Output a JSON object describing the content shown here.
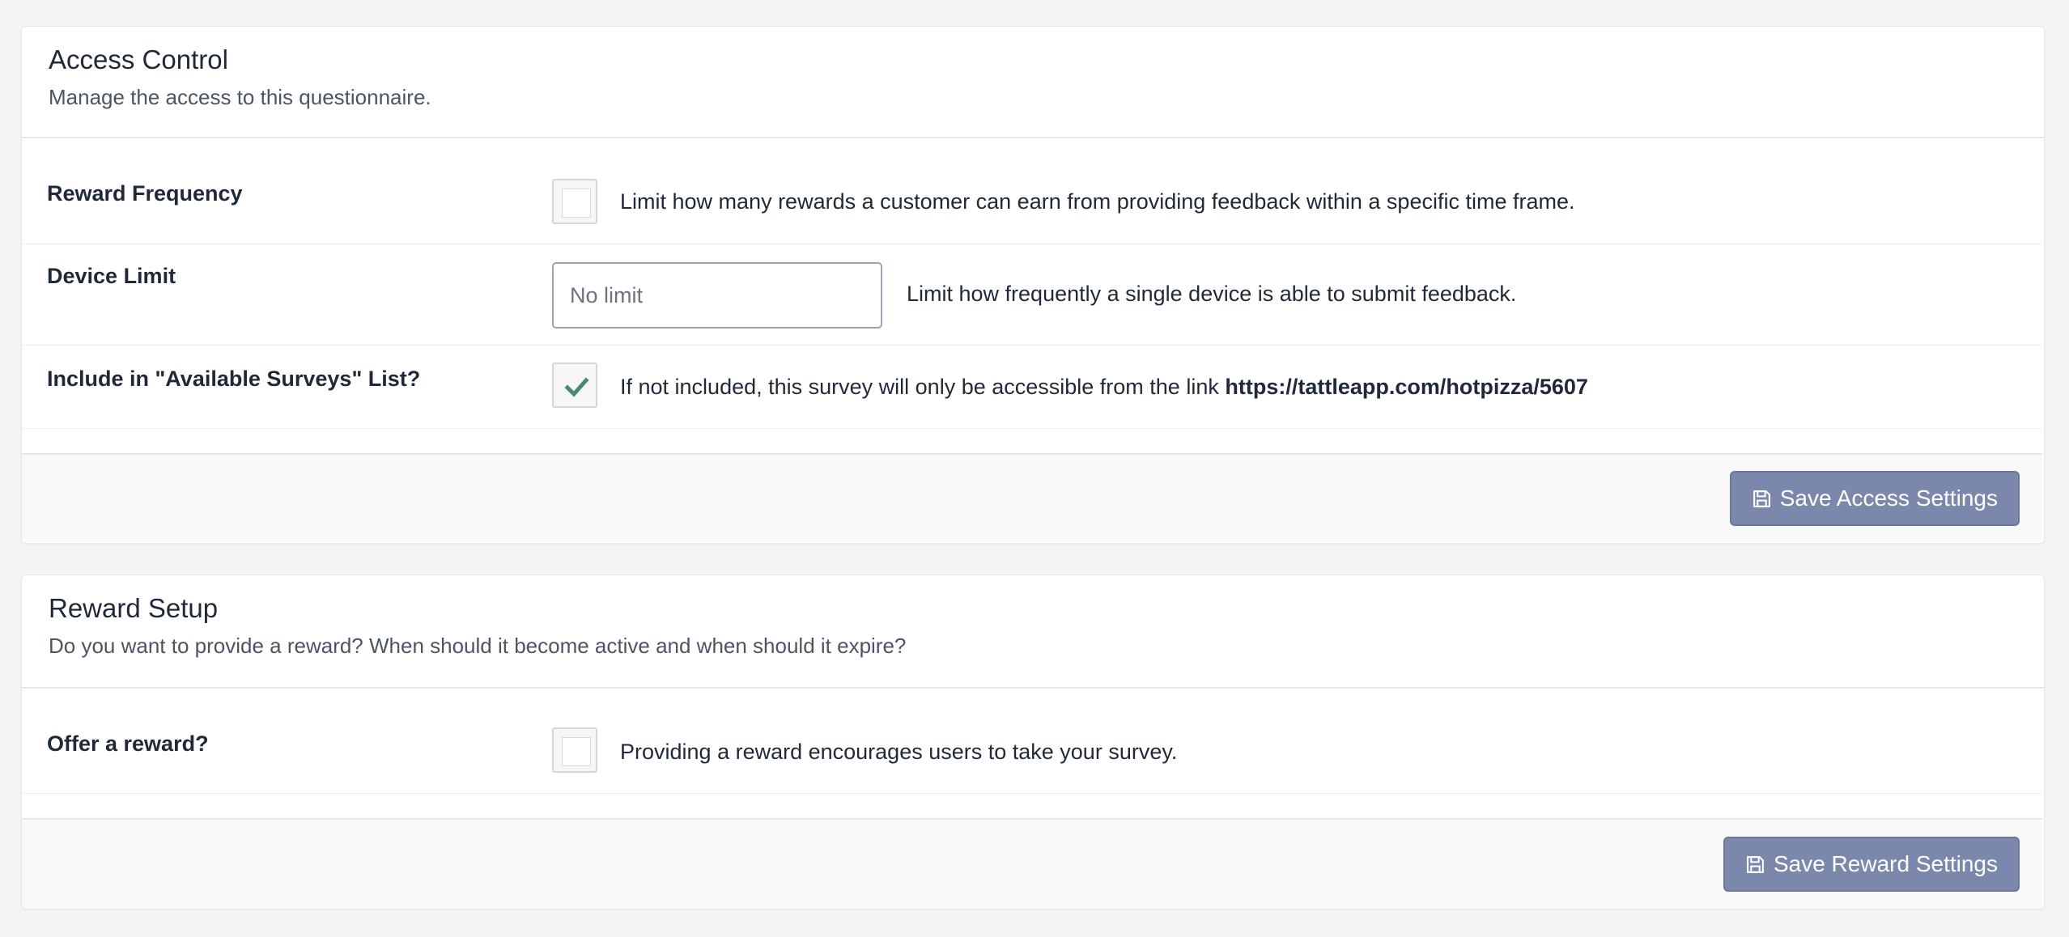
{
  "access_control": {
    "title": "Access Control",
    "subtitle": "Manage the access to this questionnaire.",
    "reward_frequency": {
      "label": "Reward Frequency",
      "checked": false,
      "help": "Limit how many rewards a customer can earn from providing feedback within a specific time frame."
    },
    "device_limit": {
      "label": "Device Limit",
      "value": "",
      "placeholder": "No limit",
      "help": "Limit how frequently a single device is able to submit feedback."
    },
    "available_surveys": {
      "label": "Include in \"Available Surveys\" List?",
      "checked": true,
      "help": "If not included, this survey will only be accessible from the link",
      "link": "https://tattleapp.com/hotpizza/5607"
    },
    "save_label": "Save Access Settings"
  },
  "reward_setup": {
    "title": "Reward Setup",
    "subtitle": "Do you want to provide a reward? When should it become active and when should it expire?",
    "offer_reward": {
      "label": "Offer a reward?",
      "checked": false,
      "help": "Providing a reward encourages users to take your survey."
    },
    "save_label": "Save Reward Settings"
  },
  "icons": {
    "save": "floppy-disk-icon",
    "check": "check-icon"
  },
  "colors": {
    "page_background": "#f3f4f6",
    "button_background": "#7c88ab",
    "checkmark": "#4a8a6c",
    "text": "#1f2937"
  }
}
